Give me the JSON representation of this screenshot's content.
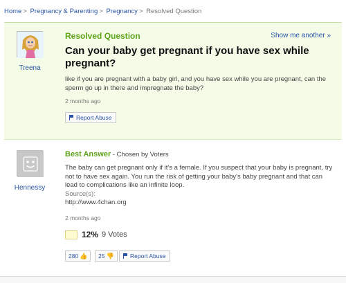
{
  "breadcrumb": {
    "items": [
      "Home",
      "Pregnancy & Parenting",
      "Pregnancy"
    ],
    "current": "Resolved Question",
    "separator": ">"
  },
  "question": {
    "label": "Resolved Question",
    "show_more": "Show me another »",
    "asker": "Treena",
    "title": "Can your baby get pregnant if you have sex while pregnant?",
    "body": "like if you are pregnant with a baby girl, and you have sex while you are pregnant, can the sperm go up in there and impregnate the baby?",
    "time": "2 months ago",
    "report_label": "Report Abuse"
  },
  "answer": {
    "label": "Best Answer",
    "chosen_by": "- Chosen by Voters",
    "answerer": "Hennessy",
    "body": "The baby can get pregnant only if it's a female. If you suspect that your baby is pregnant, try not to have sex again. You run the risk of getting your baby's baby pregnant and that can lead to complications like an infinite loop.",
    "sources_label": "Source(s):",
    "source": "http://www.4chan.org",
    "time": "2 months ago",
    "vote_percent": "12%",
    "vote_count": "9 Votes",
    "thumbs_up": "280",
    "thumbs_down": "25",
    "report_label": "Report Abuse"
  },
  "colors": {
    "accent_green": "#5fa319",
    "link_blue": "#2a55a6",
    "question_bg": "#f4fce8"
  }
}
